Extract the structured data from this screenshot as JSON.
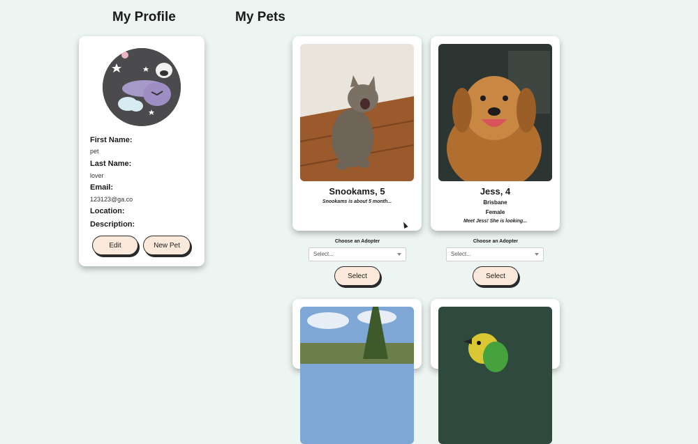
{
  "headings": {
    "profile": "My Profile",
    "pets": "My Pets"
  },
  "profile": {
    "first_name_label": "First Name:",
    "first_name": "pet",
    "last_name_label": "Last Name:",
    "last_name": "lover",
    "email_label": "Email:",
    "email": "123123@ga.co",
    "location_label": "Location:",
    "description_label": "Description:",
    "edit_label": "Edit",
    "new_pet_label": "New Pet"
  },
  "pets": [
    {
      "name": "Snookams, 5",
      "location": "",
      "gender": "",
      "description": "Snookams is about 5 month...",
      "adopter_label": "Choose an Adopter",
      "select_placeholder": "Select...",
      "select_button": "Select"
    },
    {
      "name": "Jess, 4",
      "location": "Brisbane",
      "gender": "Female",
      "description": "Meet Jess! She is looking...",
      "adopter_label": "Choose an Adopter",
      "select_placeholder": "Select...",
      "select_button": "Select"
    }
  ],
  "colors": {
    "background": "#edf5f2",
    "button": "#fbeadb",
    "card": "#ffffff"
  }
}
